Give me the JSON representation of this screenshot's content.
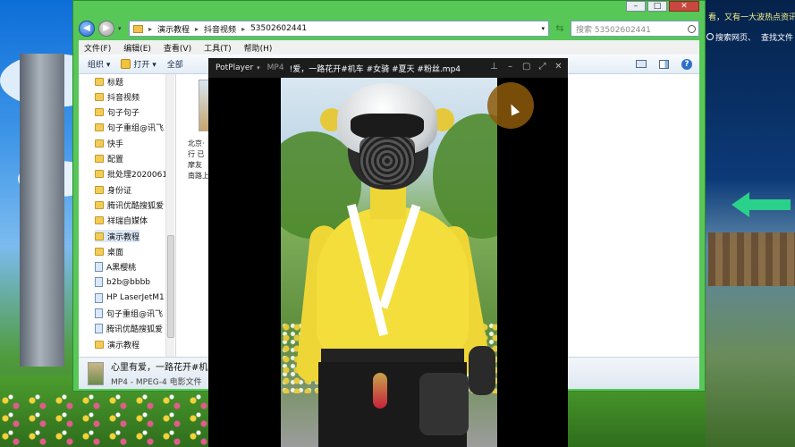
{
  "desktop": {
    "ticker_text": "看，又有一大波热点资讯E",
    "search_links": [
      "搜索网页、",
      "查找文件"
    ]
  },
  "explorer": {
    "address": {
      "crumbs": [
        "演示教程",
        "抖音视频",
        "53502602441"
      ]
    },
    "search_placeholder": "搜索 53502602441",
    "menu": [
      "文件(F)",
      "编辑(E)",
      "查看(V)",
      "工具(T)",
      "帮助(H)"
    ],
    "toolbar": {
      "organize": "组织 ▾",
      "open": "打开 ▾",
      "play_all": "全部"
    },
    "tree": [
      {
        "label": "标题",
        "type": "folder"
      },
      {
        "label": "抖音视频",
        "type": "folder"
      },
      {
        "label": "句子句子",
        "type": "folder"
      },
      {
        "label": "句子重组@讯飞",
        "type": "folder"
      },
      {
        "label": "快手",
        "type": "folder"
      },
      {
        "label": "配置",
        "type": "folder"
      },
      {
        "label": "批处理2020061",
        "type": "folder"
      },
      {
        "label": "身份证",
        "type": "folder"
      },
      {
        "label": "腾讯优酷搜狐爱",
        "type": "folder"
      },
      {
        "label": "祥瑞自媒体",
        "type": "folder"
      },
      {
        "label": "演示教程",
        "type": "folder",
        "selected": true
      },
      {
        "label": "桌面",
        "type": "folder"
      },
      {
        "label": "A黑樱桃",
        "type": "file"
      },
      {
        "label": "b2b@bbbb",
        "type": "file"
      },
      {
        "label": "HP LaserJetM1",
        "type": "file"
      },
      {
        "label": "句子重组@讯飞",
        "type": "file"
      },
      {
        "label": "腾讯优酷搜狐爱",
        "type": "file"
      },
      {
        "label": "演示教程",
        "type": "folder"
      }
    ],
    "file_caption_lines": [
      "北京·",
      "行 已",
      "摩友",
      "南路上"
    ],
    "details": {
      "name": "心里有爱，一路花开#机车",
      "type": "MP4 - MPEG-4 电影文件"
    }
  },
  "potplayer": {
    "brand": "PotPlayer",
    "format": "MP4",
    "title": "!爱，一路花开#机车 #女骑 #夏天 #粉丝.mp4"
  },
  "colors": {
    "explorer_frame": "#57c757",
    "player_bg": "#000000",
    "shirt": "#f3de3c"
  }
}
